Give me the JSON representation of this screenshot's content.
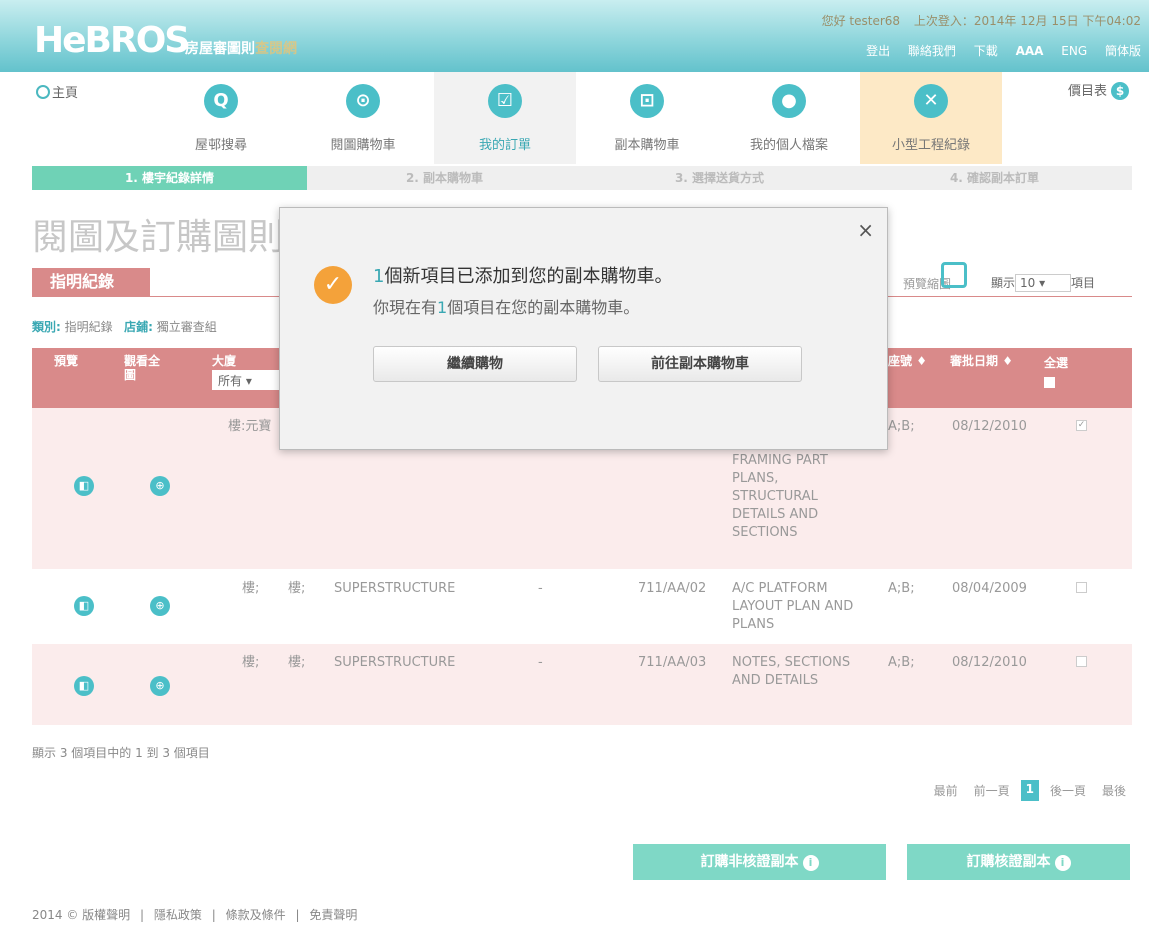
{
  "header": {
    "logo_main": "HeBROS",
    "logo_sub": "房屋審圖則",
    "logo_sub2": "查閱網",
    "greeting": "您好 tester68",
    "last_login": "上次登入：2014年 12月 15日 下午04:02",
    "links": {
      "logout": "登出",
      "contact": "聯絡我們",
      "download": "下載",
      "fontsize": "AAA",
      "eng": "ENG",
      "simplified": "簡体版"
    }
  },
  "nav": {
    "home": "主頁",
    "items": [
      {
        "label": "屋邨搜尋",
        "icon": "search-icon"
      },
      {
        "label": "閱圖購物車",
        "icon": "cart-icon"
      },
      {
        "label": "我的訂單",
        "icon": "checkbox-icon"
      },
      {
        "label": "副本購物車",
        "icon": "copy-cart-icon"
      },
      {
        "label": "我的個人檔案",
        "icon": "user-icon"
      },
      {
        "label": "小型工程紀錄",
        "icon": "tools-icon"
      }
    ],
    "pricelist": "價目表"
  },
  "steps": [
    "1. 樓宇紀錄詳情",
    "2. 副本購物車",
    "3. 選擇送貨方式",
    "4. 確認副本訂單"
  ],
  "page": {
    "title": "閱圖及訂購圖則",
    "section_tag": "指明紀錄",
    "preview_label": "預覽縮圖",
    "show_label": "顯示",
    "show_value": "10",
    "items_label": "項目",
    "filter_category_label": "類別:",
    "filter_category": "指明紀錄",
    "filter_store_label": "店鋪:",
    "filter_store": "獨立審查組"
  },
  "table": {
    "headers": {
      "preview": "預覽",
      "full": "觀看全圖",
      "block": "大廈",
      "block_filter": "所有",
      "type": "座號",
      "date": "審批日期",
      "selectall": "全選"
    },
    "rows": [
      {
        "block": "樓:元寶",
        "f1": "",
        "f2": "",
        "section": "",
        "dash": "",
        "code": "",
        "desc": "FRAMING PART PLANS, STRUCTURAL DETAILS AND SECTIONS",
        "type": "A;B;",
        "date": "08/12/2010",
        "checked": true
      },
      {
        "block": "樓;",
        "f1": "樓;",
        "f2": "",
        "section": "SUPERSTRUCTURE",
        "dash": "-",
        "code": "711/AA/02",
        "desc": "A/C PLATFORM LAYOUT PLAN AND PLANS",
        "type": "A;B;",
        "date": "08/04/2009",
        "checked": false
      },
      {
        "block": "樓;",
        "f1": "樓;",
        "f2": "",
        "section": "SUPERSTRUCTURE",
        "dash": "-",
        "code": "711/AA/03",
        "desc": "NOTES, SECTIONS AND DETAILS",
        "type": "A;B;",
        "date": "08/12/2010",
        "checked": false
      }
    ]
  },
  "summary": "顯示 3 個項目中的 1 到 3 個項目",
  "pager": {
    "first": "最前",
    "prev": "前一頁",
    "current": "1",
    "next": "後一頁",
    "last": "最後"
  },
  "actions": {
    "non_cert": "訂購非核證副本",
    "cert": "訂購核證副本"
  },
  "footer": [
    "2014 © 版權聲明",
    "|",
    "隱私政策",
    "|",
    "條款及條件",
    "|",
    "免責聲明"
  ],
  "modal": {
    "count1": "1",
    "line1": "個新項目已添加到您的副本購物車。",
    "line2_pre": "你現在有",
    "count2": "1",
    "line2_post": "個項目在您的副本購物車。",
    "continue": "繼續購物",
    "goto_cart": "前往副本購物車"
  }
}
